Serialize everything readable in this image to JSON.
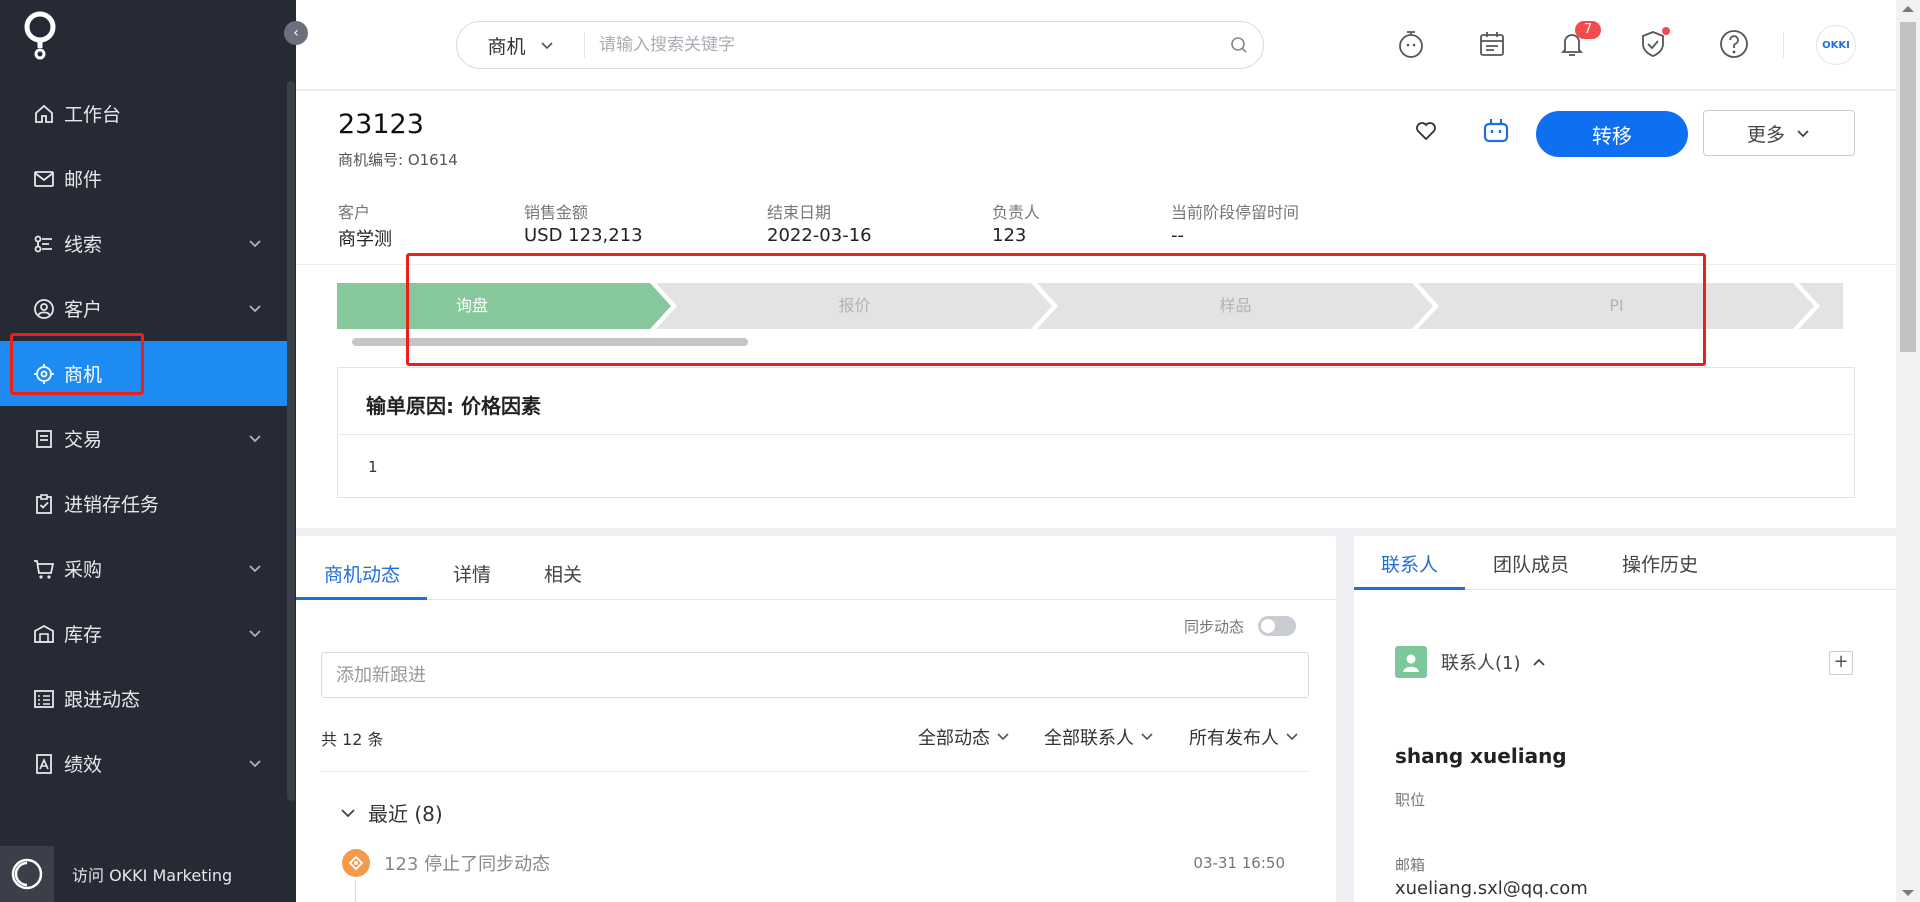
{
  "sidebar": {
    "items": [
      {
        "label": "工作台",
        "icon": "home-icon",
        "has_children": false
      },
      {
        "label": "邮件",
        "icon": "mail-icon",
        "has_children": false
      },
      {
        "label": "线索",
        "icon": "leads-icon",
        "has_children": true
      },
      {
        "label": "客户",
        "icon": "customer-icon",
        "has_children": true
      },
      {
        "label": "商机",
        "icon": "target-icon",
        "has_children": false,
        "active": true
      },
      {
        "label": "交易",
        "icon": "document-icon",
        "has_children": true
      },
      {
        "label": "进销存任务",
        "icon": "clipboard-icon",
        "has_children": false
      },
      {
        "label": "采购",
        "icon": "cart-icon",
        "has_children": true
      },
      {
        "label": "库存",
        "icon": "warehouse-icon",
        "has_children": true
      },
      {
        "label": "跟进动态",
        "icon": "list-icon",
        "has_children": false
      },
      {
        "label": "绩效",
        "icon": "chart-icon",
        "has_children": true
      }
    ],
    "footer_label": "访问 OKKI Marketing"
  },
  "topbar": {
    "search_scope": "商机",
    "search_placeholder": "请输入搜索关键字",
    "notification_count": "7",
    "avatar_text": "OKKI"
  },
  "header": {
    "title": "23123",
    "opp_number": "商机编号: O1614",
    "transfer_label": "转移",
    "more_label": "更多",
    "info": [
      {
        "label": "客户",
        "value": "商学测"
      },
      {
        "label": "销售金额",
        "value": "USD 123,213"
      },
      {
        "label": "结束日期",
        "value": "2022-03-16"
      },
      {
        "label": "负责人",
        "value": "123"
      },
      {
        "label": "当前阶段停留时间",
        "value": "--"
      }
    ],
    "stages": [
      {
        "label": "询盘",
        "state": "active"
      },
      {
        "label": "报价",
        "state": "pending"
      },
      {
        "label": "样品",
        "state": "pending"
      },
      {
        "label": "PI",
        "state": "pending"
      }
    ],
    "loss_reason_title": "输单原因: 价格因素",
    "loss_reason_value": "1"
  },
  "left_panel": {
    "tabs": [
      "商机动态",
      "详情",
      "相关"
    ],
    "sync_label": "同步动态",
    "add_placeholder": "添加新跟进",
    "count_label": "共 12 条",
    "filters": [
      "全部动态",
      "全部联系人",
      "所有发布人"
    ],
    "recent_label": "最近 (8)",
    "activity_text": "123 停止了同步动态",
    "activity_time": "03-31 16:50"
  },
  "right_panel": {
    "tabs": [
      "联系人",
      "团队成员",
      "操作历史"
    ],
    "contacts_label": "联系人(1)",
    "contact_name": "shang xueliang",
    "position_label": "职位",
    "email_label": "邮箱",
    "email_value": "xueliang.sxl@qq.com"
  },
  "colors": {
    "sidebar_bg": "#252a34",
    "active_blue": "#1e8bf3",
    "primary_button": "#0f6ff1",
    "stage_active": "#86c79b",
    "stage_pending": "#e3e3e3",
    "highlight_red": "#e8221b"
  }
}
